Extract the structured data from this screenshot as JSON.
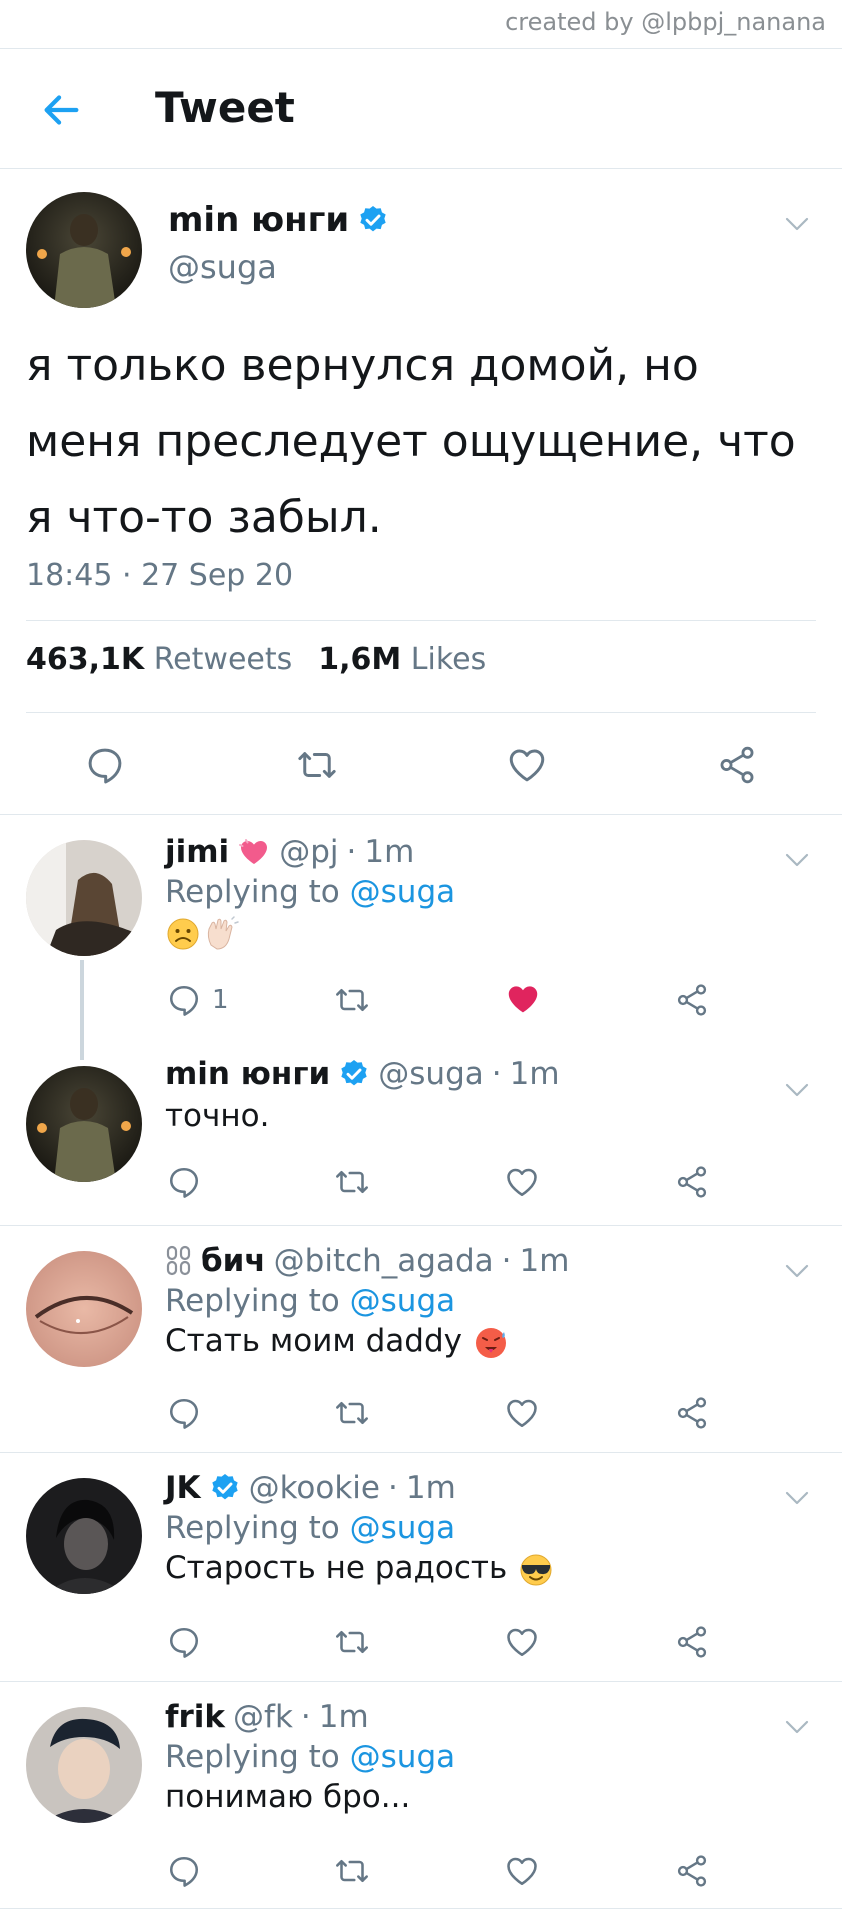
{
  "credit": "created by @lpbpj_nanana",
  "header": {
    "title": "Tweet"
  },
  "main_tweet": {
    "name": "min юнги",
    "handle": "@suga",
    "text": "я только вернулся домой, но меня преследует ощущение, что я что-то забыл.",
    "timestamp": "18:45 · 27 Sep 20",
    "retweets_count": "463,1K",
    "retweets_label": "Retweets",
    "likes_count": "1,6M",
    "likes_label": "Likes"
  },
  "replies": [
    {
      "name": "jimi",
      "handle": "@pj",
      "time": "1m",
      "replying_label": "Replying to",
      "replying_to": "@suga",
      "text": "",
      "reply_count": "1",
      "liked": true
    },
    {
      "name": "min юнги",
      "handle": "@suga",
      "time": "1m",
      "text": "точно."
    },
    {
      "name": "бич",
      "handle": "@bitch_agada",
      "time": "1m",
      "replying_label": "Replying to",
      "replying_to": "@suga",
      "text": "Стать моим daddy"
    },
    {
      "name": "JK",
      "handle": "@kookie",
      "time": "1m",
      "replying_label": "Replying to",
      "replying_to": "@suga",
      "text": "Старость не радость"
    },
    {
      "name": "frik",
      "handle": "@fk",
      "time": "1m",
      "replying_label": "Replying to",
      "replying_to": "@suga",
      "text": "понимаю бро..."
    }
  ],
  "colors": {
    "accent": "#1da1f2",
    "link": "#1b95e0",
    "secondary_text": "#657786",
    "like_red": "#e0245e",
    "border": "#e1e8ed"
  },
  "icons": [
    "back-arrow-icon",
    "verified-badge-icon",
    "chevron-down-icon",
    "reply-icon",
    "retweet-icon",
    "like-icon",
    "share-icon"
  ]
}
